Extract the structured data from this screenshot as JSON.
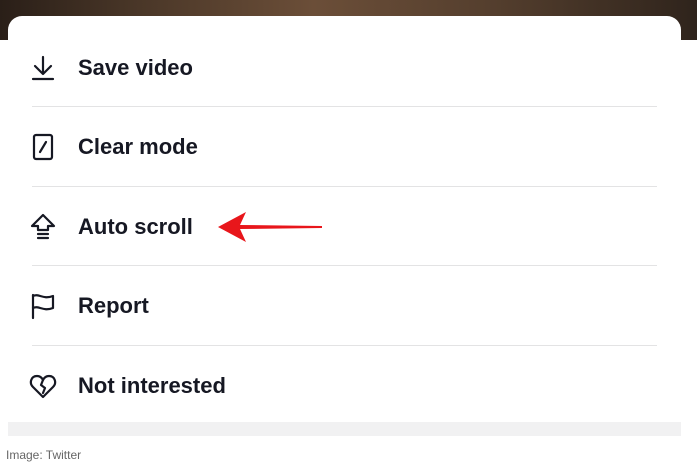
{
  "menu": {
    "items": [
      {
        "label": "Save video",
        "icon": "download-icon"
      },
      {
        "label": "Clear mode",
        "icon": "clear-mode-icon"
      },
      {
        "label": "Auto scroll",
        "icon": "auto-scroll-icon"
      },
      {
        "label": "Report",
        "icon": "flag-icon"
      },
      {
        "label": "Not interested",
        "icon": "broken-heart-icon"
      }
    ]
  },
  "annotation": {
    "color": "#e8161b",
    "points_to": "Auto scroll"
  },
  "caption": "Image: Twitter",
  "colors": {
    "text": "#161823",
    "divider": "#e3e3e4",
    "sheet": "#ffffff"
  }
}
